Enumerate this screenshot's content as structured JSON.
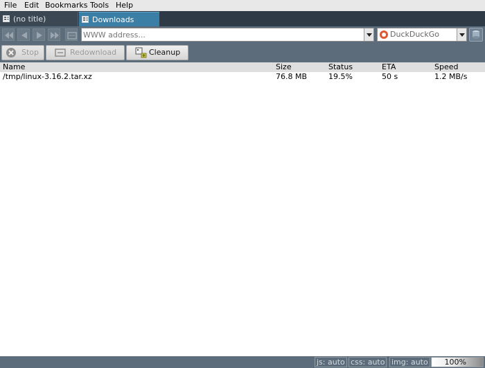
{
  "menu": [
    "File",
    "Edit",
    "Bookmarks",
    "Tools",
    "Help"
  ],
  "tabs": [
    {
      "label": "(no title)",
      "active": false
    },
    {
      "label": "Downloads",
      "active": true
    }
  ],
  "toolbar": {
    "url_placeholder": "WWW address...",
    "url_value": "",
    "search_engine": "DuckDuckGo"
  },
  "download_toolbar": {
    "stop_label": "Stop",
    "redownload_label": "Redownload",
    "cleanup_label": "Cleanup"
  },
  "downloads": {
    "columns": [
      "Name",
      "Size",
      "Status",
      "ETA",
      "Speed"
    ],
    "rows": [
      {
        "name": "/tmp/linux-3.16.2.tar.xz",
        "size": "76.8 MB",
        "status": "19.5%",
        "eta": "50 s",
        "speed": "1.2 MB/s"
      }
    ]
  },
  "statusbar": {
    "js": "js: auto",
    "css": "css: auto",
    "img": "img: auto",
    "zoom": "100%"
  },
  "colors": {
    "chrome": "#5c6c7a",
    "active_tab": "#3b7ea6",
    "tab_strip": "#2e3a46"
  }
}
